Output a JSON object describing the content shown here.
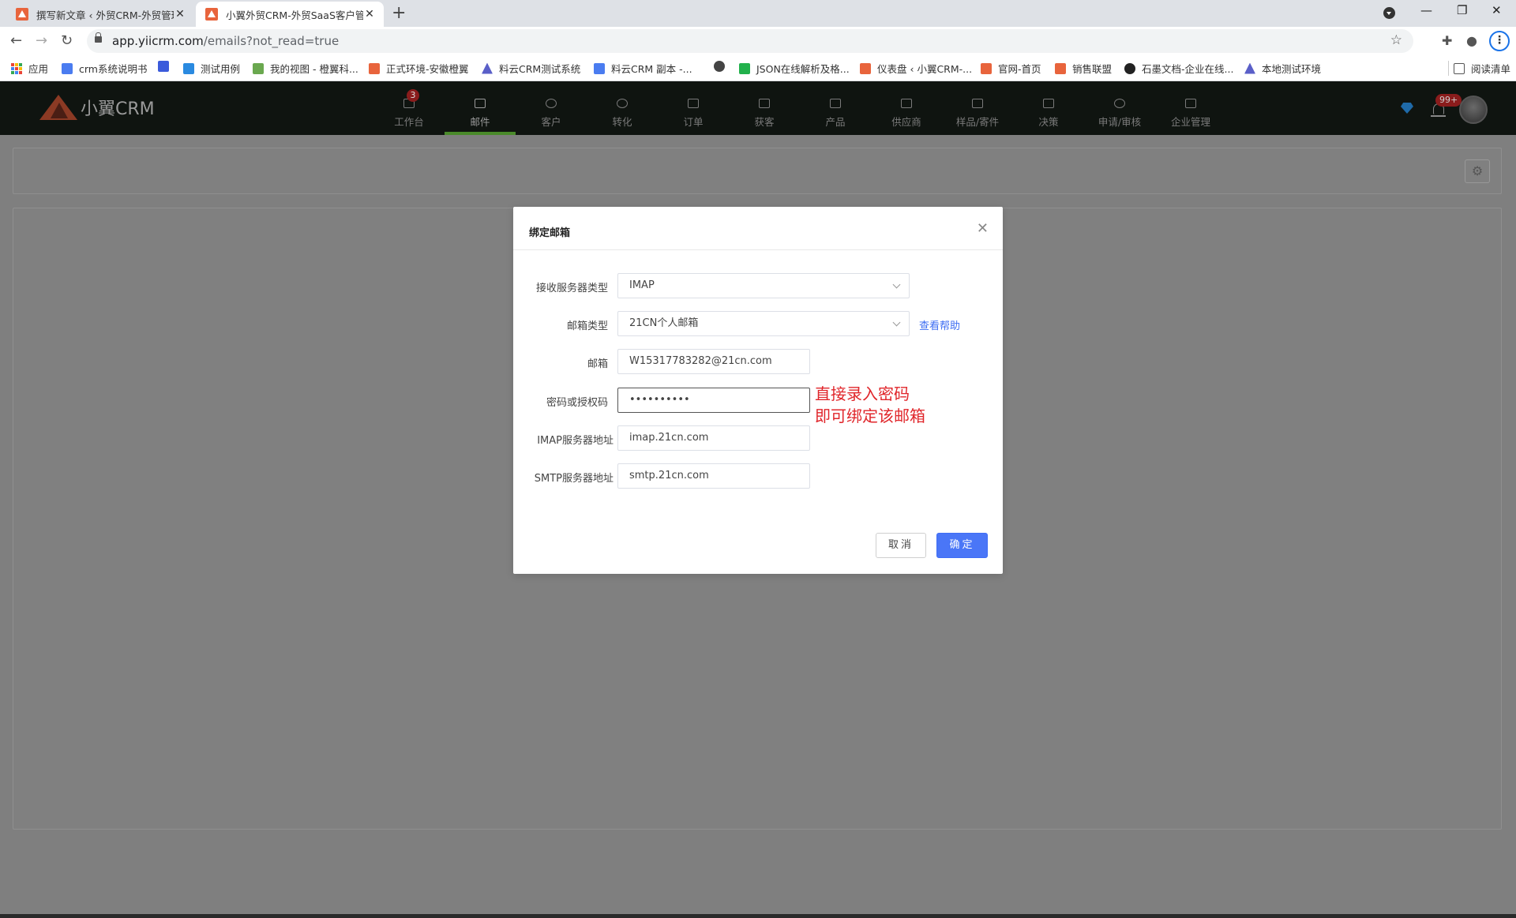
{
  "browser": {
    "tabs": [
      {
        "title": "撰写新文章 ‹ 外贸CRM-外贸管理",
        "active": false
      },
      {
        "title": "小翼外贸CRM-外贸SaaS客户管理",
        "active": true
      }
    ],
    "url_host": "app.yiicrm.com",
    "url_path": "/emails?not_read=true",
    "bookmarks": [
      {
        "label": "应用",
        "icon": "apps-grid-icon"
      },
      {
        "label": "crm系统说明书",
        "icon": "doc-icon"
      },
      {
        "label": "",
        "icon": "app-icon"
      },
      {
        "label": "测试用例",
        "icon": "app-icon"
      },
      {
        "label": "我的视图 - 橙翼科...",
        "icon": "app-icon"
      },
      {
        "label": "正式环境-安徽橙翼",
        "icon": "brand-icon"
      },
      {
        "label": "料云CRM测试系统",
        "icon": "triangle-icon"
      },
      {
        "label": "料云CRM 副本 -...",
        "icon": "doc-icon"
      },
      {
        "label": "",
        "icon": "globe-icon"
      },
      {
        "label": "JSON在线解析及格...",
        "icon": "json-icon"
      },
      {
        "label": "仪表盘 ‹ 小翼CRM-...",
        "icon": "brand-icon"
      },
      {
        "label": "官网-首页",
        "icon": "brand-icon"
      },
      {
        "label": "销售联盟",
        "icon": "brand-icon"
      },
      {
        "label": "石墨文档-企业在线...",
        "icon": "shimo-icon"
      },
      {
        "label": "本地测试环境",
        "icon": "triangle-icon"
      }
    ],
    "reading_list": "阅读清单"
  },
  "app": {
    "logo_text": "小翼CRM",
    "nav": [
      {
        "label": "工作台",
        "badge": "3",
        "icon": "workbench-icon"
      },
      {
        "label": "邮件",
        "active": true,
        "icon": "mail-icon"
      },
      {
        "label": "客户",
        "icon": "customer-icon"
      },
      {
        "label": "转化",
        "icon": "convert-icon"
      },
      {
        "label": "订单",
        "icon": "order-icon"
      },
      {
        "label": "获客",
        "icon": "acquire-icon"
      },
      {
        "label": "产品",
        "icon": "product-icon"
      },
      {
        "label": "供应商",
        "icon": "supplier-icon"
      },
      {
        "label": "样品/寄件",
        "icon": "sample-icon"
      },
      {
        "label": "决策",
        "icon": "decision-icon"
      },
      {
        "label": "申请/审核",
        "icon": "approval-icon"
      },
      {
        "label": "企业管理",
        "icon": "company-icon"
      }
    ],
    "notification_badge": "99+",
    "colors": {
      "header_bg": "#0f1410",
      "active_underline": "#4a8a2a",
      "primary": "#4a76f7",
      "link": "#3d6df2",
      "annotation": "#e0252a"
    }
  },
  "modal": {
    "title": "绑定邮箱",
    "fields": {
      "server_type": {
        "label": "接收服务器类型",
        "value": "IMAP"
      },
      "mailbox_type": {
        "label": "邮箱类型",
        "value": "21CN个人邮箱",
        "help": "查看帮助"
      },
      "email": {
        "label": "邮箱",
        "value": "W15317783282@21cn.com"
      },
      "password": {
        "label": "密码或授权码",
        "value": "••••••••••"
      },
      "imap": {
        "label": "IMAP服务器地址",
        "value": "imap.21cn.com"
      },
      "smtp": {
        "label": "SMTP服务器地址",
        "value": "smtp.21cn.com"
      }
    },
    "annotation_line1": "直接录入密码",
    "annotation_line2": "即可绑定该邮箱",
    "cancel_label": "取消",
    "ok_label": "确定"
  }
}
